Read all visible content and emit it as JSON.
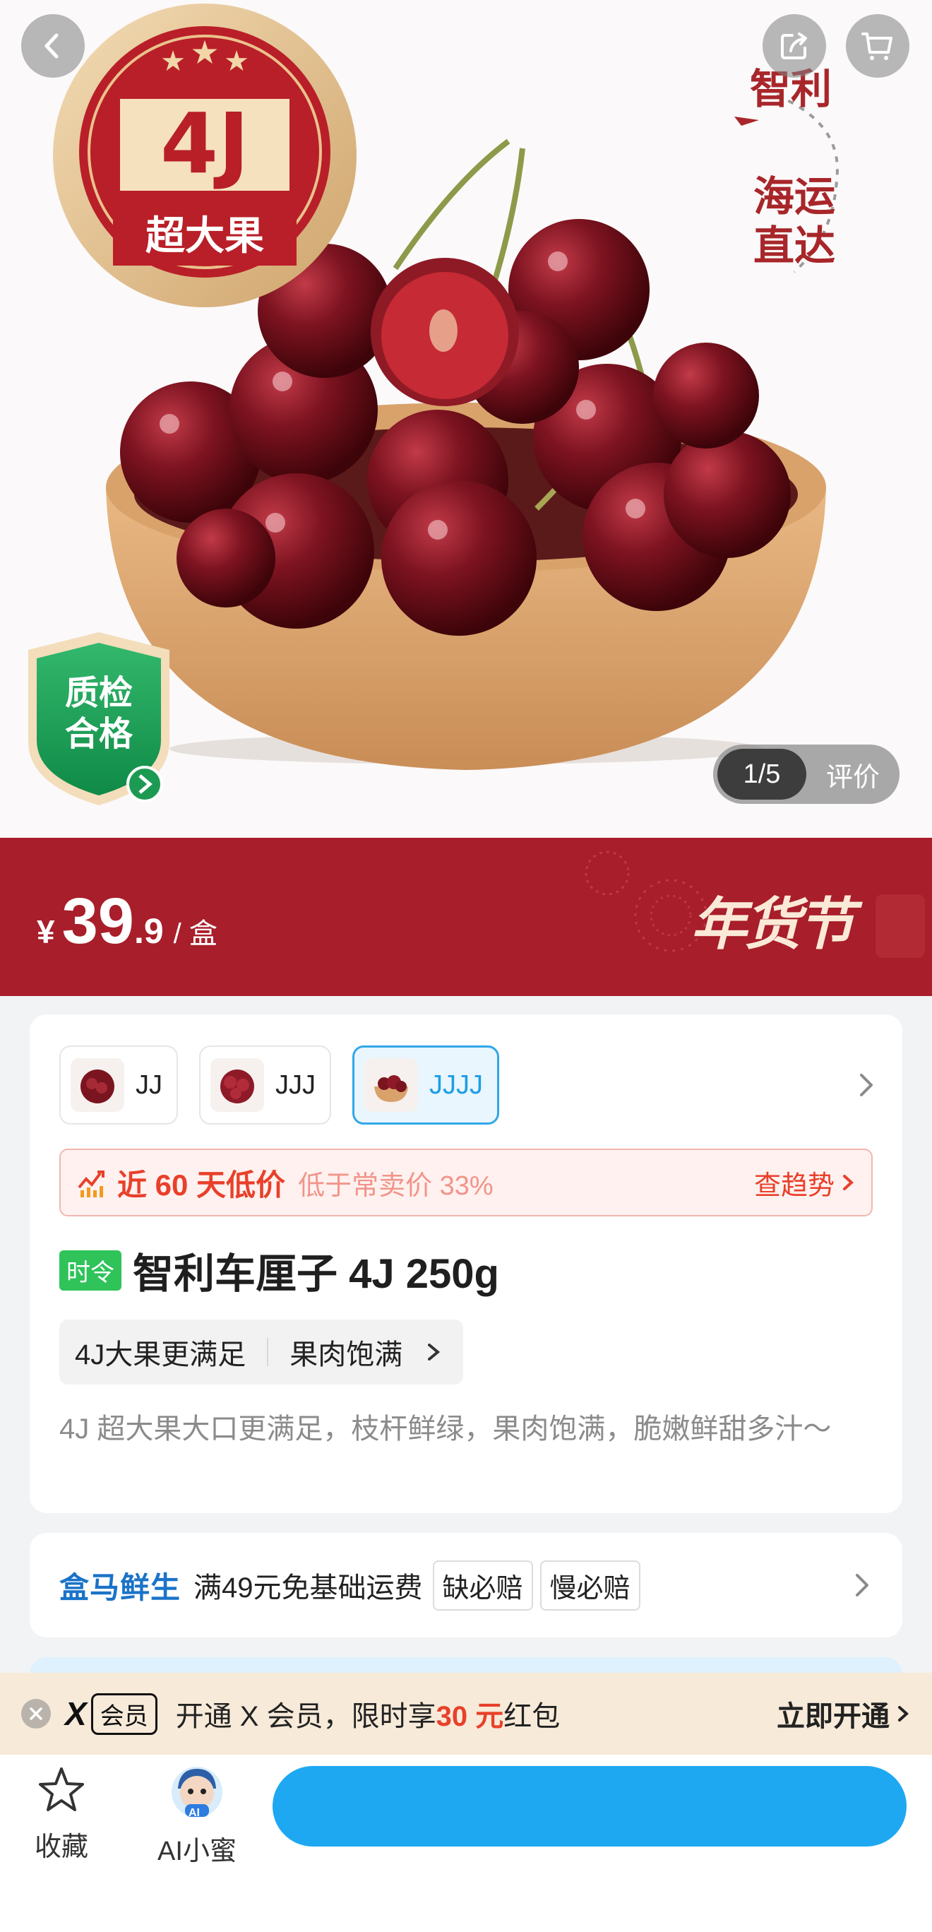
{
  "hero": {
    "badge_size": "4J",
    "badge_text": "超大果",
    "brand_origin": "智利",
    "shipping_line1": "海运",
    "shipping_line2": "直达",
    "qc_line1": "质检",
    "qc_line2": "合格",
    "pager": "1/5",
    "review_label": "评价"
  },
  "price": {
    "currency": "¥",
    "integer": "39",
    "decimal": ".9",
    "unit": "/ 盒",
    "festival": "年货节"
  },
  "variants": [
    {
      "label": "JJ",
      "selected": false
    },
    {
      "label": "JJJ",
      "selected": false
    },
    {
      "label": "JJJJ",
      "selected": true
    }
  ],
  "low_price": {
    "main": "近 60 天低价",
    "sub": "低于常卖价 33%",
    "link": "查趋势"
  },
  "product": {
    "tag": "时令",
    "title": "智利车厘子 4J 250g",
    "chips": [
      "4J大果更满足",
      "果肉饱满"
    ],
    "description": "4J 超大果大口更满足，枝杆鲜绿，果肉饱满，脆嫩鲜甜多汁～"
  },
  "shipping": {
    "brand": "盒马鲜生",
    "text": "满49元免基础运费",
    "pills": [
      "缺必赔",
      "慢必赔"
    ]
  },
  "member": {
    "logo": "X",
    "vip": "会员",
    "text_before": "开通 X 会员，限时享",
    "amount": "30 元",
    "text_after": "红包",
    "cta": "立即开通"
  },
  "bottom": {
    "favorite_label": "收藏",
    "assistant_label": "AI小蜜",
    "assistant_badge": "AI"
  },
  "colors": {
    "brand_red": "#a81e2a",
    "accent_blue": "#1ea8f2",
    "alert_red": "#e8402a",
    "seasonal_green": "#2fc35a"
  }
}
